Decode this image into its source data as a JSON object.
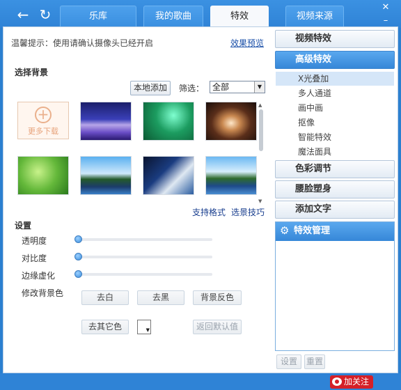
{
  "tabs": [
    {
      "label": "乐库",
      "active": false
    },
    {
      "label": "我的歌曲",
      "active": false
    },
    {
      "label": "特效",
      "active": true
    },
    {
      "label": "视频来源",
      "active": false
    }
  ],
  "nav": {
    "back_icon": "arrow-left-icon",
    "refresh_icon": "refresh-icon"
  },
  "window": {
    "close_icon": "close-icon",
    "minimize_icon": "minimize-icon"
  },
  "tip": "温馨提示：使用请确认摄像头已经开启",
  "preview_link": "效果预览",
  "background": {
    "title": "选择背景",
    "add_local": "本地添加",
    "filter_label": "筛选：",
    "filter_value": "全部",
    "more_download": "更多下载",
    "support_format": "支持格式",
    "bg_tips": "选景技巧"
  },
  "settings": {
    "title": "设置",
    "sliders": [
      {
        "label": "透明度",
        "value": 0
      },
      {
        "label": "对比度",
        "value": 0
      },
      {
        "label": "边缘虚化",
        "value": 0
      }
    ],
    "bg_color_label": "修改背景色",
    "btn_remove_white": "去白",
    "btn_remove_black": "去黑",
    "btn_invert_bg": "背景反色",
    "btn_remove_other": "去其它色",
    "btn_restore_default": "返回默认值"
  },
  "sidebar": {
    "sections": [
      {
        "label": "视频特效",
        "active": false
      },
      {
        "label": "高级特效",
        "active": true
      },
      {
        "label": "色彩调节",
        "active": false
      },
      {
        "label": "腰脸塑身",
        "active": false
      },
      {
        "label": "添加文字",
        "active": false
      }
    ],
    "advanced_items": [
      "X光叠加",
      "多人通道",
      "画中画",
      "抠像",
      "智能特效",
      "魔法面具"
    ],
    "selected_item": "X光叠加",
    "manager": {
      "title": "特效管理",
      "gear_icon": "gear-icon"
    },
    "btn_settings": "设置",
    "btn_reset": "重置"
  },
  "footer": {
    "follow_label": "加关注"
  },
  "colors": {
    "accent": "#2f83d6",
    "active_tab_bg": "#f7f9fc",
    "link": "#1a3f8f",
    "badge": "#d52028"
  }
}
